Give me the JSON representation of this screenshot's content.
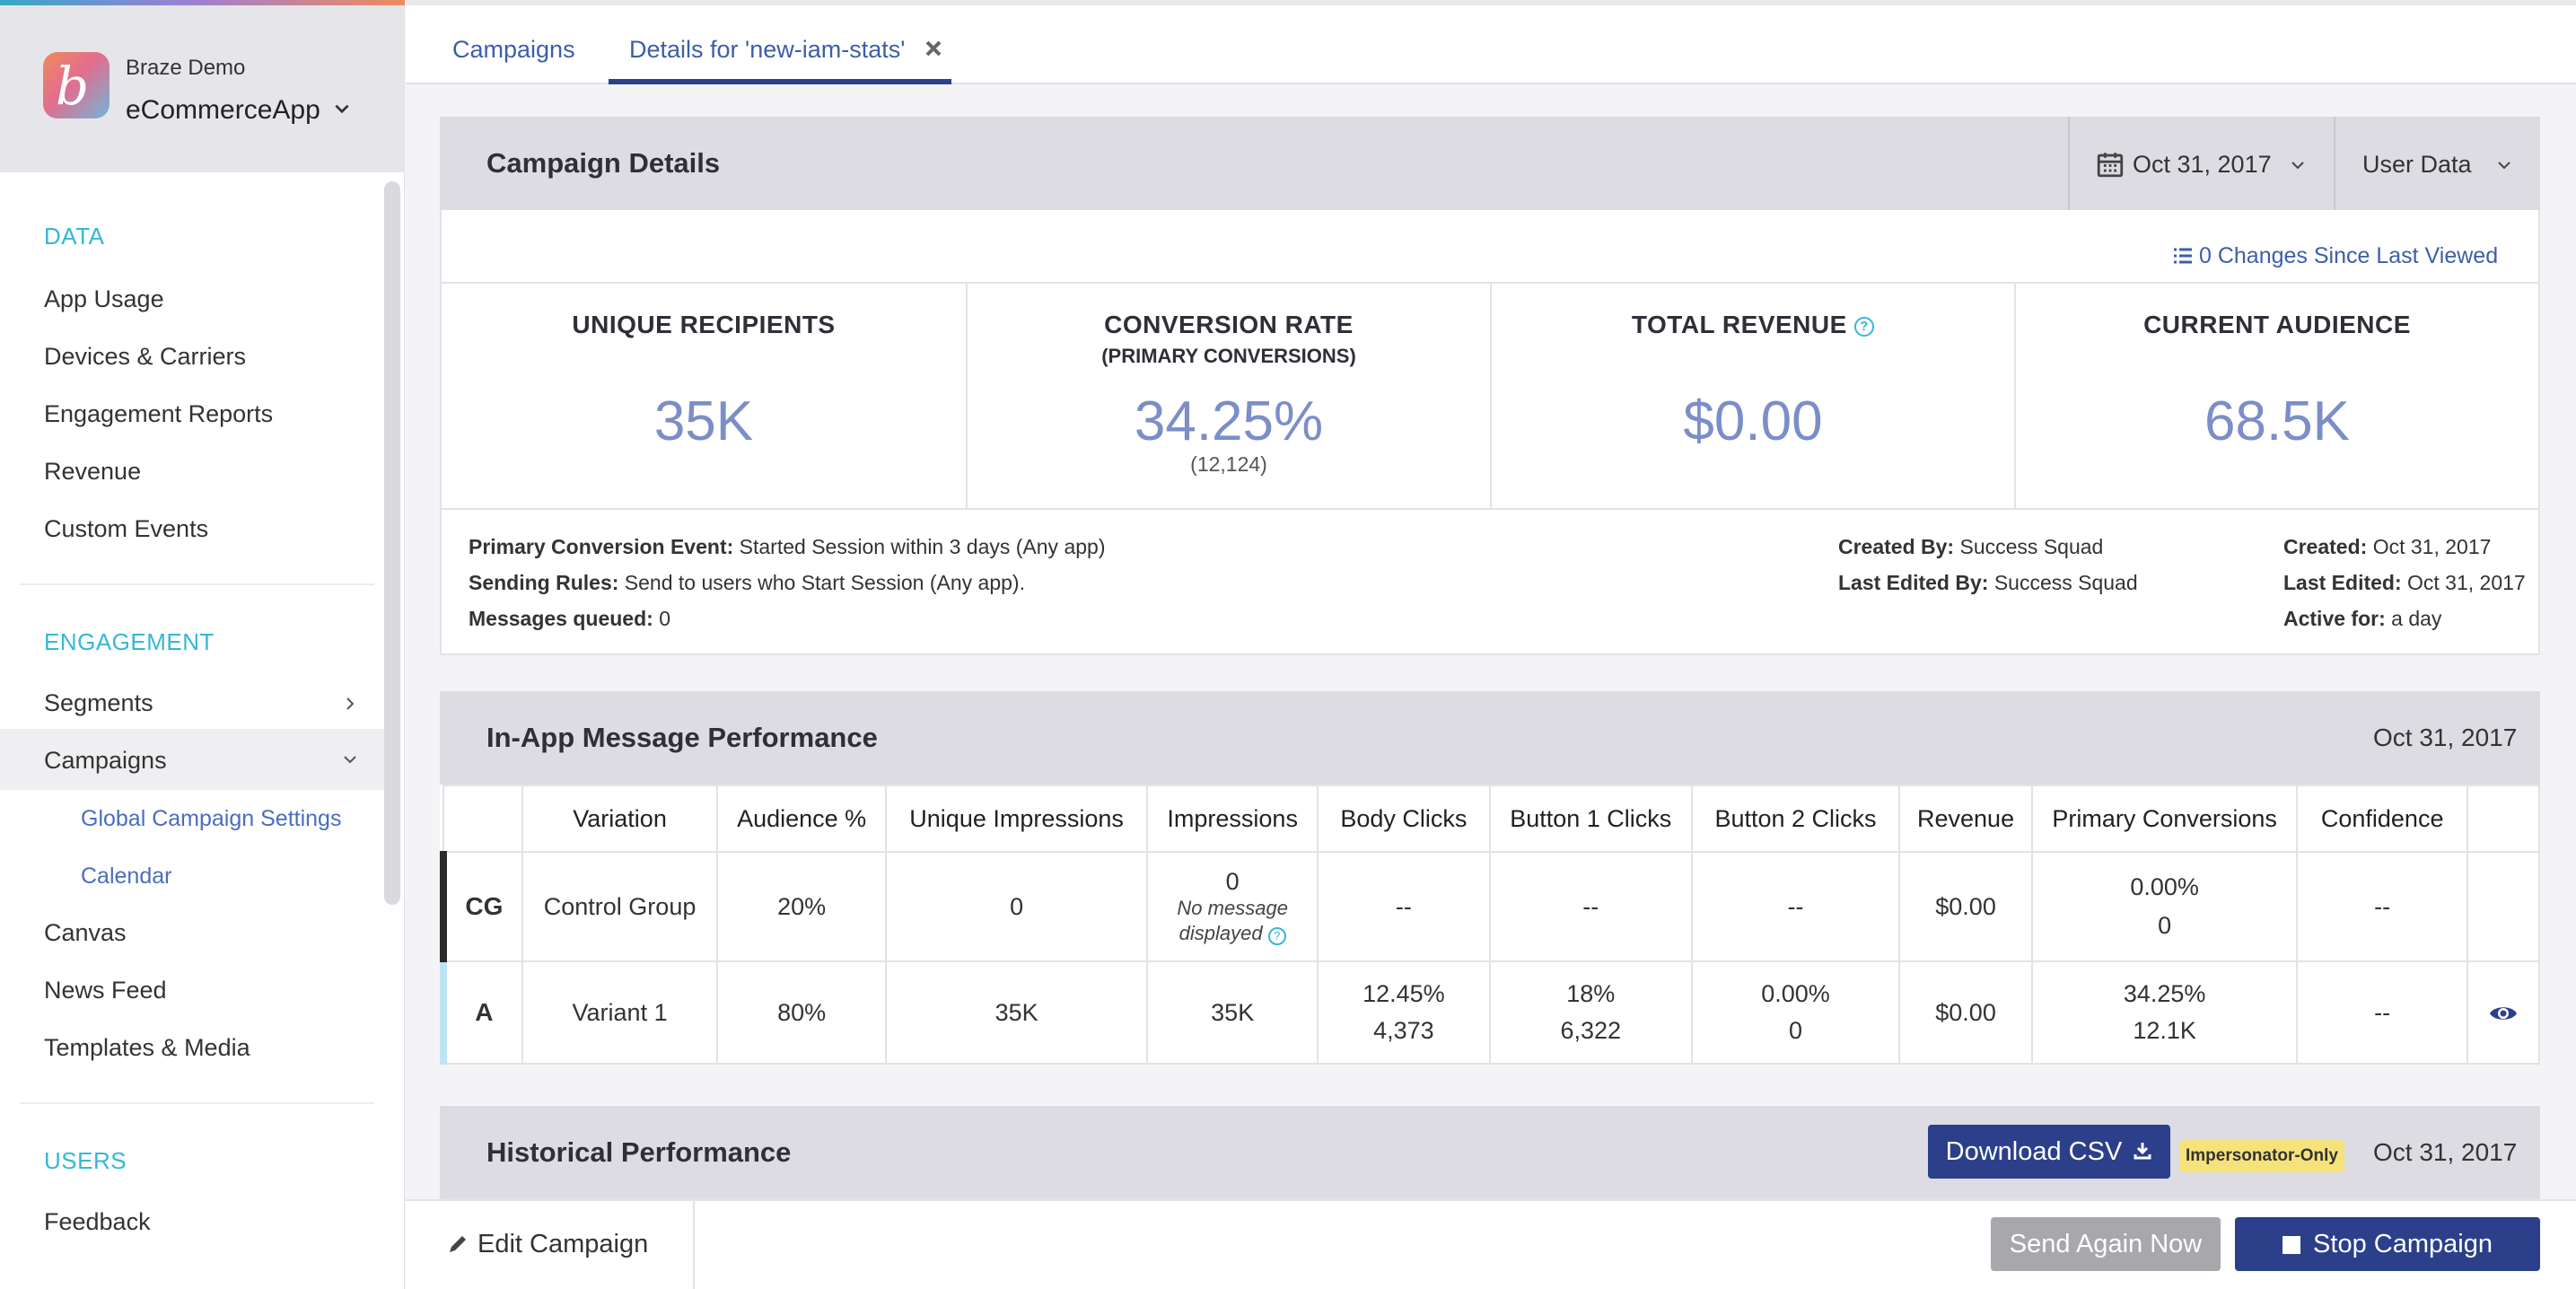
{
  "sidebar": {
    "org_name": "Braze Demo",
    "app_name": "eCommerceApp",
    "sections": [
      {
        "title": "DATA",
        "items": [
          "App Usage",
          "Devices & Carriers",
          "Engagement Reports",
          "Revenue",
          "Custom Events"
        ]
      },
      {
        "title": "ENGAGEMENT",
        "items": [
          "Segments",
          "Campaigns",
          "Global Campaign Settings",
          "Calendar",
          "Canvas",
          "News Feed",
          "Templates & Media"
        ]
      },
      {
        "title": "USERS",
        "items": [
          "Feedback"
        ]
      }
    ]
  },
  "tabs": {
    "campaigns": "Campaigns",
    "details": "Details for 'new-iam-stats'"
  },
  "campaign_details": {
    "title": "Campaign Details",
    "date": "Oct 31, 2017",
    "user_data": "User Data",
    "changes": "0 Changes Since Last Viewed",
    "stats": [
      {
        "label": "UNIQUE RECIPIENTS",
        "sub": "",
        "value": "35K",
        "note": ""
      },
      {
        "label": "CONVERSION RATE",
        "sub": "(PRIMARY CONVERSIONS)",
        "value": "34.25%",
        "note": "(12,124)"
      },
      {
        "label": "TOTAL REVENUE",
        "sub": "",
        "value": "$0.00",
        "note": ""
      },
      {
        "label": "CURRENT AUDIENCE",
        "sub": "",
        "value": "68.5K",
        "note": ""
      }
    ],
    "meta": {
      "primary_conversion_label": "Primary Conversion Event:",
      "primary_conversion_value": "Started Session within 3 days (Any app)",
      "sending_rules_label": "Sending Rules:",
      "sending_rules_value": "Send to users who Start Session (Any app).",
      "queued_label": "Messages queued:",
      "queued_value": "0",
      "created_by_label": "Created By:",
      "created_by_value": "Success Squad",
      "last_edited_by_label": "Last Edited By:",
      "last_edited_by_value": "Success Squad",
      "created_label": "Created:",
      "created_value": "Oct 31, 2017",
      "last_edited_label": "Last Edited:",
      "last_edited_value": "Oct 31, 2017",
      "active_label": "Active for:",
      "active_value": "a day"
    }
  },
  "iam_performance": {
    "title": "In-App Message Performance",
    "date": "Oct 31, 2017",
    "columns": [
      "Variation",
      "Audience %",
      "Unique Impressions",
      "Impressions",
      "Body Clicks",
      "Button 1 Clicks",
      "Button 2 Clicks",
      "Revenue",
      "Primary Conversions",
      "Confidence"
    ],
    "rows": [
      {
        "tag": "CG",
        "variation": "Control Group",
        "audience": "20%",
        "unique": "0",
        "impressions": "0",
        "impressions_note": "No message displayed",
        "body_a": "--",
        "body_b": "",
        "btn1_a": "--",
        "btn1_b": "",
        "btn2_a": "--",
        "btn2_b": "",
        "revenue": "$0.00",
        "conv_a": "0.00%",
        "conv_b": "0",
        "confidence": "--"
      },
      {
        "tag": "A",
        "variation": "Variant 1",
        "audience": "80%",
        "unique": "35K",
        "impressions": "35K",
        "impressions_note": "",
        "body_a": "12.45%",
        "body_b": "4,373",
        "btn1_a": "18%",
        "btn1_b": "6,322",
        "btn2_a": "0.00%",
        "btn2_b": "0",
        "revenue": "$0.00",
        "conv_a": "34.25%",
        "conv_b": "12.1K",
        "confidence": "--"
      }
    ]
  },
  "historical": {
    "title": "Historical Performance",
    "download": "Download CSV",
    "badge": "Impersonator-Only",
    "date": "Oct 31, 2017"
  },
  "bottom": {
    "edit": "Edit Campaign",
    "send_again": "Send Again Now",
    "stop": "Stop Campaign"
  },
  "colors": {
    "accent": "#2c3f8a",
    "link": "#3d5ea8",
    "section": "#36b6d8",
    "stat": "#7b8ec8"
  }
}
